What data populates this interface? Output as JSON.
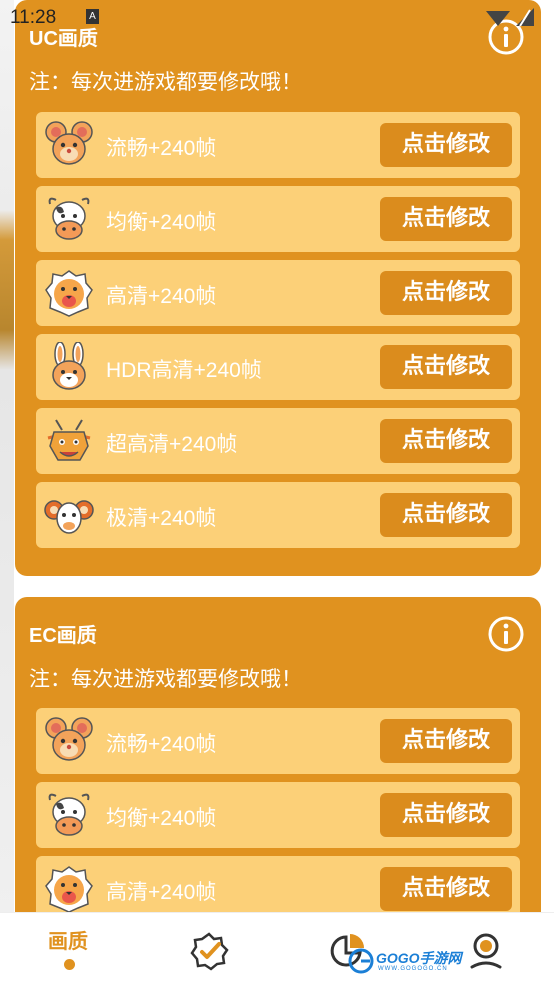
{
  "status_bar": {
    "time": "11:28",
    "badge": "A"
  },
  "colors": {
    "card": "#e0921f",
    "row": "#fcd078",
    "button": "#db8c1d"
  },
  "sections": [
    {
      "title": "UC画质",
      "note": "注：每次进游戏都要修改哦！",
      "rows": [
        {
          "icon": "mouse-icon",
          "label": "流畅+240帧",
          "button": "点击修改"
        },
        {
          "icon": "ox-icon",
          "label": "均衡+240帧",
          "button": "点击修改"
        },
        {
          "icon": "tiger-icon",
          "label": "高清+240帧",
          "button": "点击修改"
        },
        {
          "icon": "rabbit-icon",
          "label": "HDR高清+240帧",
          "button": "点击修改"
        },
        {
          "icon": "dragon-icon",
          "label": "超高清+240帧",
          "button": "点击修改"
        },
        {
          "icon": "ram-icon",
          "label": "极清+240帧",
          "button": "点击修改"
        }
      ]
    },
    {
      "title": "EC画质",
      "note": "注：每次进游戏都要修改哦！",
      "rows": [
        {
          "icon": "mouse-icon",
          "label": "流畅+240帧",
          "button": "点击修改"
        },
        {
          "icon": "ox-icon",
          "label": "均衡+240帧",
          "button": "点击修改"
        },
        {
          "icon": "tiger-icon",
          "label": "高清+240帧",
          "button": "点击修改"
        }
      ]
    }
  ],
  "bottom_nav": {
    "active_label": "画质",
    "items": [
      "picture-quality-tab",
      "verified-badge-icon",
      "pie-chart-icon",
      "profile-icon"
    ]
  },
  "watermark": {
    "text": "GOGO手游网",
    "sub": "WWW.GOGOGO.CN"
  }
}
